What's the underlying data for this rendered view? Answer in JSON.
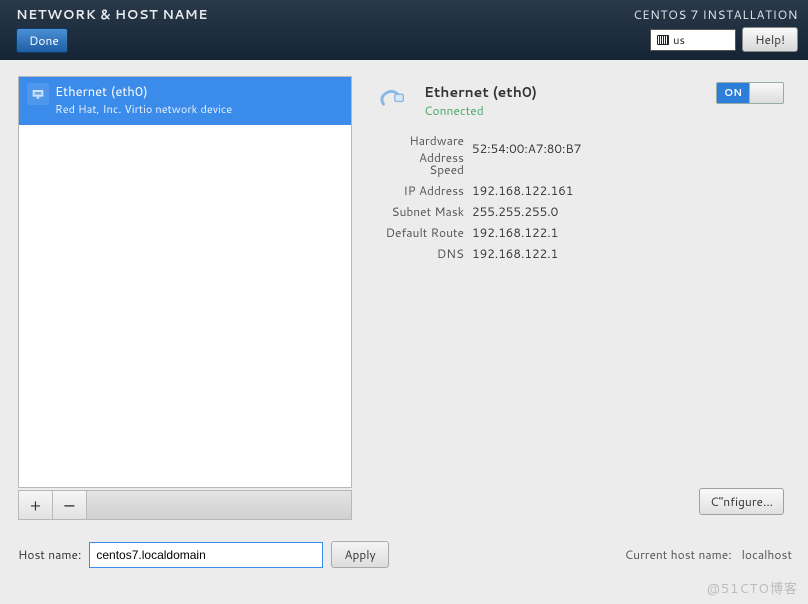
{
  "header": {
    "title": "NETWORK & HOST NAME",
    "done_label": "Done",
    "install_title": "CENTOS 7 INSTALLATION",
    "keyboard": "us",
    "help_label": "Help!"
  },
  "network_list": {
    "items": [
      {
        "title": "Ethernet (eth0)",
        "vendor": "Red Hat, Inc. Virtio network device"
      }
    ]
  },
  "toolbar": {
    "add_label": "+",
    "remove_label": "−"
  },
  "details": {
    "title": "Ethernet (eth0)",
    "status": "Connected",
    "toggle_on_label": "ON",
    "rows": {
      "hw_addr_label": "Hardware Address",
      "hw_addr": "52:54:00:A7:80:B7",
      "speed_label": "Speed",
      "speed": "",
      "ip_label": "IP Address",
      "ip": "192.168.122.161",
      "mask_label": "Subnet Mask",
      "mask": "255.255.255.0",
      "route_label": "Default Route",
      "route": "192.168.122.1",
      "dns_label": "DNS",
      "dns": "192.168.122.1"
    },
    "configure_label": "C\"nfigure..."
  },
  "hostname": {
    "label": "Host name:",
    "value": "centos7.localdomain",
    "apply_label": "Apply",
    "current_label": "Current host name:",
    "current_value": "localhost"
  },
  "watermark": "@51CTO博客"
}
